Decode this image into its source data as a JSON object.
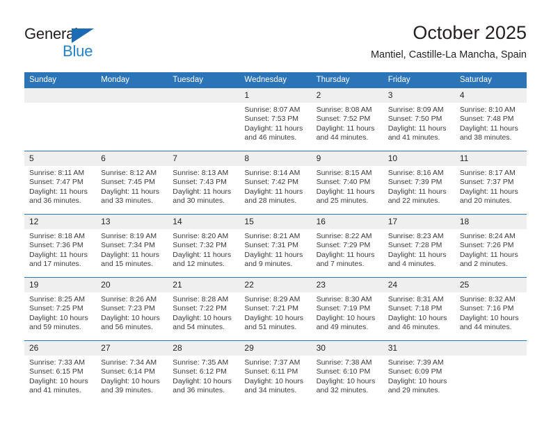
{
  "brand": {
    "line1": "General",
    "line2": "Blue",
    "triangle_color": "#1c6cb5",
    "line2_color": "#2283c7"
  },
  "header": {
    "title": "October 2025",
    "subtitle": "Mantiel, Castille-La Mancha, Spain"
  },
  "theme": {
    "header_blue": "#2b74b8",
    "daynum_bg": "#efefef",
    "text": "#231f20"
  },
  "calendar": {
    "weekday_headers": [
      "Sunday",
      "Monday",
      "Tuesday",
      "Wednesday",
      "Thursday",
      "Friday",
      "Saturday"
    ],
    "weeks": [
      [
        {
          "day": "",
          "empty": true,
          "sunrise": "",
          "sunset": "",
          "daylight_l1": "",
          "daylight_l2": ""
        },
        {
          "day": "",
          "empty": true,
          "sunrise": "",
          "sunset": "",
          "daylight_l1": "",
          "daylight_l2": ""
        },
        {
          "day": "",
          "empty": true,
          "sunrise": "",
          "sunset": "",
          "daylight_l1": "",
          "daylight_l2": ""
        },
        {
          "day": "1",
          "sunrise": "Sunrise: 8:07 AM",
          "sunset": "Sunset: 7:53 PM",
          "daylight_l1": "Daylight: 11 hours",
          "daylight_l2": "and 46 minutes."
        },
        {
          "day": "2",
          "sunrise": "Sunrise: 8:08 AM",
          "sunset": "Sunset: 7:52 PM",
          "daylight_l1": "Daylight: 11 hours",
          "daylight_l2": "and 44 minutes."
        },
        {
          "day": "3",
          "sunrise": "Sunrise: 8:09 AM",
          "sunset": "Sunset: 7:50 PM",
          "daylight_l1": "Daylight: 11 hours",
          "daylight_l2": "and 41 minutes."
        },
        {
          "day": "4",
          "sunrise": "Sunrise: 8:10 AM",
          "sunset": "Sunset: 7:48 PM",
          "daylight_l1": "Daylight: 11 hours",
          "daylight_l2": "and 38 minutes."
        }
      ],
      [
        {
          "day": "5",
          "sunrise": "Sunrise: 8:11 AM",
          "sunset": "Sunset: 7:47 PM",
          "daylight_l1": "Daylight: 11 hours",
          "daylight_l2": "and 36 minutes."
        },
        {
          "day": "6",
          "sunrise": "Sunrise: 8:12 AM",
          "sunset": "Sunset: 7:45 PM",
          "daylight_l1": "Daylight: 11 hours",
          "daylight_l2": "and 33 minutes."
        },
        {
          "day": "7",
          "sunrise": "Sunrise: 8:13 AM",
          "sunset": "Sunset: 7:43 PM",
          "daylight_l1": "Daylight: 11 hours",
          "daylight_l2": "and 30 minutes."
        },
        {
          "day": "8",
          "sunrise": "Sunrise: 8:14 AM",
          "sunset": "Sunset: 7:42 PM",
          "daylight_l1": "Daylight: 11 hours",
          "daylight_l2": "and 28 minutes."
        },
        {
          "day": "9",
          "sunrise": "Sunrise: 8:15 AM",
          "sunset": "Sunset: 7:40 PM",
          "daylight_l1": "Daylight: 11 hours",
          "daylight_l2": "and 25 minutes."
        },
        {
          "day": "10",
          "sunrise": "Sunrise: 8:16 AM",
          "sunset": "Sunset: 7:39 PM",
          "daylight_l1": "Daylight: 11 hours",
          "daylight_l2": "and 22 minutes."
        },
        {
          "day": "11",
          "sunrise": "Sunrise: 8:17 AM",
          "sunset": "Sunset: 7:37 PM",
          "daylight_l1": "Daylight: 11 hours",
          "daylight_l2": "and 20 minutes."
        }
      ],
      [
        {
          "day": "12",
          "sunrise": "Sunrise: 8:18 AM",
          "sunset": "Sunset: 7:36 PM",
          "daylight_l1": "Daylight: 11 hours",
          "daylight_l2": "and 17 minutes."
        },
        {
          "day": "13",
          "sunrise": "Sunrise: 8:19 AM",
          "sunset": "Sunset: 7:34 PM",
          "daylight_l1": "Daylight: 11 hours",
          "daylight_l2": "and 15 minutes."
        },
        {
          "day": "14",
          "sunrise": "Sunrise: 8:20 AM",
          "sunset": "Sunset: 7:32 PM",
          "daylight_l1": "Daylight: 11 hours",
          "daylight_l2": "and 12 minutes."
        },
        {
          "day": "15",
          "sunrise": "Sunrise: 8:21 AM",
          "sunset": "Sunset: 7:31 PM",
          "daylight_l1": "Daylight: 11 hours",
          "daylight_l2": "and 9 minutes."
        },
        {
          "day": "16",
          "sunrise": "Sunrise: 8:22 AM",
          "sunset": "Sunset: 7:29 PM",
          "daylight_l1": "Daylight: 11 hours",
          "daylight_l2": "and 7 minutes."
        },
        {
          "day": "17",
          "sunrise": "Sunrise: 8:23 AM",
          "sunset": "Sunset: 7:28 PM",
          "daylight_l1": "Daylight: 11 hours",
          "daylight_l2": "and 4 minutes."
        },
        {
          "day": "18",
          "sunrise": "Sunrise: 8:24 AM",
          "sunset": "Sunset: 7:26 PM",
          "daylight_l1": "Daylight: 11 hours",
          "daylight_l2": "and 2 minutes."
        }
      ],
      [
        {
          "day": "19",
          "sunrise": "Sunrise: 8:25 AM",
          "sunset": "Sunset: 7:25 PM",
          "daylight_l1": "Daylight: 10 hours",
          "daylight_l2": "and 59 minutes."
        },
        {
          "day": "20",
          "sunrise": "Sunrise: 8:26 AM",
          "sunset": "Sunset: 7:23 PM",
          "daylight_l1": "Daylight: 10 hours",
          "daylight_l2": "and 56 minutes."
        },
        {
          "day": "21",
          "sunrise": "Sunrise: 8:28 AM",
          "sunset": "Sunset: 7:22 PM",
          "daylight_l1": "Daylight: 10 hours",
          "daylight_l2": "and 54 minutes."
        },
        {
          "day": "22",
          "sunrise": "Sunrise: 8:29 AM",
          "sunset": "Sunset: 7:21 PM",
          "daylight_l1": "Daylight: 10 hours",
          "daylight_l2": "and 51 minutes."
        },
        {
          "day": "23",
          "sunrise": "Sunrise: 8:30 AM",
          "sunset": "Sunset: 7:19 PM",
          "daylight_l1": "Daylight: 10 hours",
          "daylight_l2": "and 49 minutes."
        },
        {
          "day": "24",
          "sunrise": "Sunrise: 8:31 AM",
          "sunset": "Sunset: 7:18 PM",
          "daylight_l1": "Daylight: 10 hours",
          "daylight_l2": "and 46 minutes."
        },
        {
          "day": "25",
          "sunrise": "Sunrise: 8:32 AM",
          "sunset": "Sunset: 7:16 PM",
          "daylight_l1": "Daylight: 10 hours",
          "daylight_l2": "and 44 minutes."
        }
      ],
      [
        {
          "day": "26",
          "sunrise": "Sunrise: 7:33 AM",
          "sunset": "Sunset: 6:15 PM",
          "daylight_l1": "Daylight: 10 hours",
          "daylight_l2": "and 41 minutes."
        },
        {
          "day": "27",
          "sunrise": "Sunrise: 7:34 AM",
          "sunset": "Sunset: 6:14 PM",
          "daylight_l1": "Daylight: 10 hours",
          "daylight_l2": "and 39 minutes."
        },
        {
          "day": "28",
          "sunrise": "Sunrise: 7:35 AM",
          "sunset": "Sunset: 6:12 PM",
          "daylight_l1": "Daylight: 10 hours",
          "daylight_l2": "and 36 minutes."
        },
        {
          "day": "29",
          "sunrise": "Sunrise: 7:37 AM",
          "sunset": "Sunset: 6:11 PM",
          "daylight_l1": "Daylight: 10 hours",
          "daylight_l2": "and 34 minutes."
        },
        {
          "day": "30",
          "sunrise": "Sunrise: 7:38 AM",
          "sunset": "Sunset: 6:10 PM",
          "daylight_l1": "Daylight: 10 hours",
          "daylight_l2": "and 32 minutes."
        },
        {
          "day": "31",
          "sunrise": "Sunrise: 7:39 AM",
          "sunset": "Sunset: 6:09 PM",
          "daylight_l1": "Daylight: 10 hours",
          "daylight_l2": "and 29 minutes."
        },
        {
          "day": "",
          "empty": true,
          "sunrise": "",
          "sunset": "",
          "daylight_l1": "",
          "daylight_l2": ""
        }
      ]
    ]
  }
}
